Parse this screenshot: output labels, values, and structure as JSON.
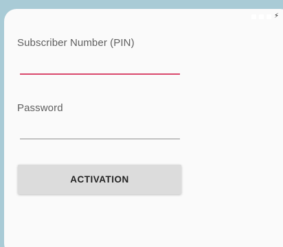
{
  "status_bar": {
    "icons": [
      "signal-icon",
      "wifi-icon",
      "battery-icon",
      "charging-icon"
    ]
  },
  "form": {
    "pin_label": "Subscriber Number (PIN)",
    "pin_value": "",
    "password_label": "Password",
    "password_value": "",
    "activation_label": "ACTIVATION"
  },
  "colors": {
    "background": "#a9cbd6",
    "screen": "#fafafa",
    "focused_underline": "#d9476b",
    "button_bg": "#dcdcdc"
  }
}
